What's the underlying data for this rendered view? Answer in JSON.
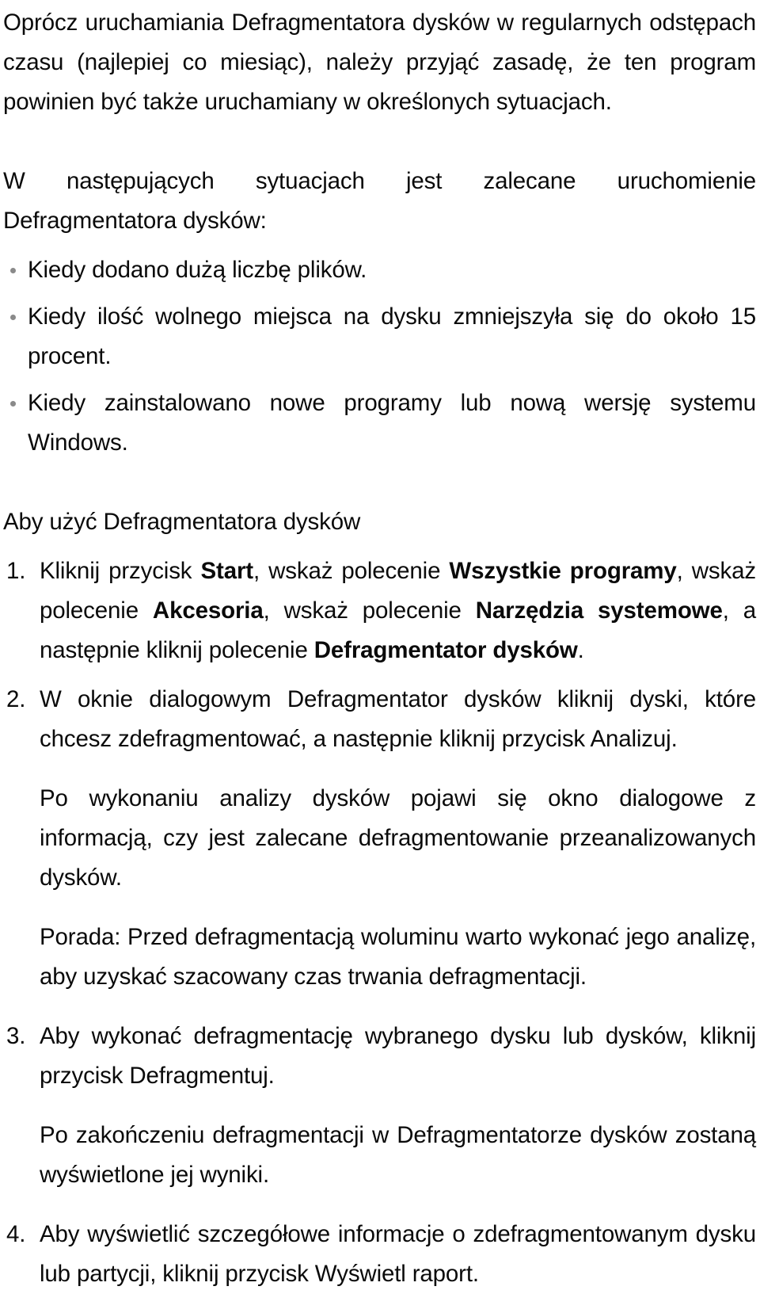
{
  "document": {
    "language": "pl",
    "text_color": "#0a0a0a",
    "background_color": "#ffffff",
    "bullet_color": "#8a8a8a"
  },
  "intro": {
    "paragraph_1": "Oprócz uruchamiania Defragmentatora dysków w regularnych odstępach czasu (najlepiej co miesiąc), należy przyjąć zasadę, że ten program powinien być także uruchamiany w określonych sytuacjach.",
    "paragraph_2": "W następujących sytuacjach jest zalecane uruchomienie Defragmentatora dysków:"
  },
  "situations": {
    "items": [
      "Kiedy dodano dużą liczbę plików.",
      "Kiedy ilość wolnego miejsca na dysku zmniejszyła się do około 15 procent.",
      "Kiedy zainstalowano nowe programy lub nową wersję systemu Windows."
    ]
  },
  "howto": {
    "heading": "Aby użyć Defragmentatora dysków",
    "steps": [
      {
        "number": "1.",
        "segments": [
          {
            "text": "Kliknij przycisk ",
            "bold": false
          },
          {
            "text": "Start",
            "bold": true
          },
          {
            "text": ", wskaż polecenie ",
            "bold": false
          },
          {
            "text": "Wszystkie programy",
            "bold": true
          },
          {
            "text": ", wskaż polecenie ",
            "bold": false
          },
          {
            "text": "Akcesoria",
            "bold": true
          },
          {
            "text": ", wskaż polecenie ",
            "bold": false
          },
          {
            "text": "Narzędzia systemowe",
            "bold": true
          },
          {
            "text": ", a następnie kliknij polecenie ",
            "bold": false
          },
          {
            "text": "Defragmentator dysków",
            "bold": true
          },
          {
            "text": ".",
            "bold": false
          }
        ]
      },
      {
        "number": "2.",
        "segments": [
          {
            "text": "W oknie dialogowym Defragmentator dysków kliknij dyski, które chcesz zdefragmentować, a następnie kliknij przycisk Analizuj.",
            "bold": false
          }
        ]
      },
      {
        "number": "3.",
        "segments": [
          {
            "text": "Aby wykonać defragmentację wybranego dysku lub dysków, kliknij przycisk Defragmentuj.",
            "bold": false
          }
        ]
      },
      {
        "number": "4.",
        "segments": [
          {
            "text": "Aby wyświetlić szczegółowe informacje o zdefragmentowanym dysku lub partycji, kliknij przycisk Wyświetl raport.",
            "bold": false
          }
        ]
      }
    ],
    "note_after_step_2": "Po wykonaniu analizy dysków pojawi się okno dialogowe z informacją, czy jest zalecane defragmentowanie przeanalizowanych dysków.",
    "tip": "Porada: Przed defragmentacją woluminu warto wykonać jego analizę, aby uzyskać szacowany czas trwania defragmentacji.",
    "note_after_step_3": "Po zakończeniu defragmentacji w Defragmentatorze dysków zostaną wyświetlone jej wyniki."
  }
}
